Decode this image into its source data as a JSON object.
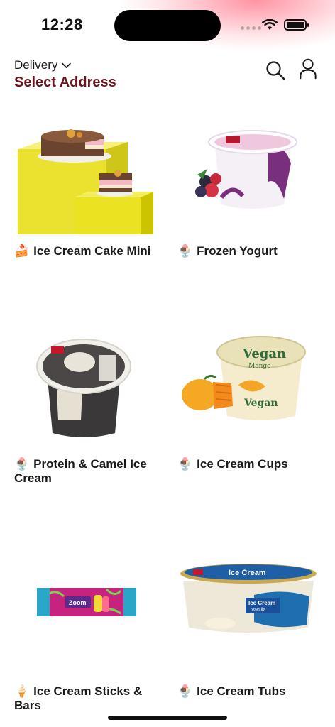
{
  "status_bar": {
    "time": "12:28"
  },
  "header": {
    "delivery_label": "Delivery",
    "address_label": "Select Address",
    "accent_color": "#6b1520"
  },
  "categories": [
    {
      "emoji": "🍰",
      "name": "Ice Cream Cake Mini",
      "icon": "cake-emoji"
    },
    {
      "emoji": "🍨",
      "name": "Frozen Yogurt",
      "icon": "ice-cream-cup-emoji"
    },
    {
      "emoji": "🍨",
      "name": "Protein & Camel Ice Cream",
      "icon": "ice-cream-cup-emoji"
    },
    {
      "emoji": "🍨",
      "name": "Ice Cream Cups",
      "icon": "ice-cream-cup-emoji"
    },
    {
      "emoji": "🍦",
      "name": "Ice Cream Sticks & Bars",
      "icon": "ice-cream-cone-emoji"
    },
    {
      "emoji": "🍨",
      "name": "Ice Cream Tubs",
      "icon": "ice-cream-cup-emoji"
    }
  ],
  "product_texts": {
    "vegan_brand": "Vegan",
    "vegan_flavor": "Mango",
    "zoom_brand": "Zoom",
    "tub_title": "Ice Cream",
    "tub_flavor": "Vanilla"
  }
}
